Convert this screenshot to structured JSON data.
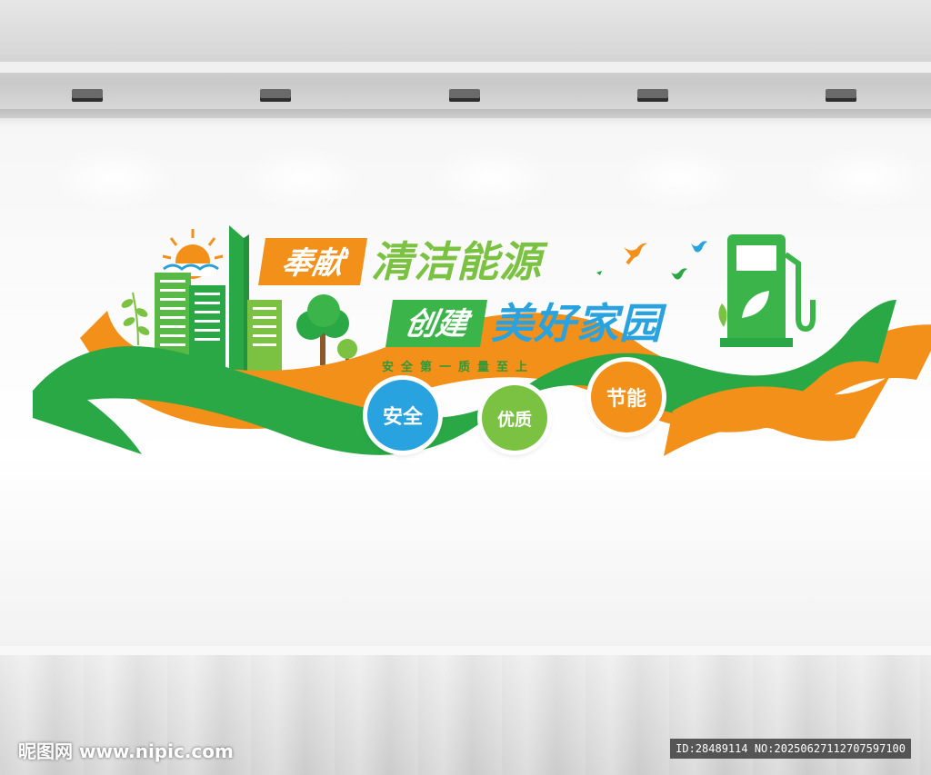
{
  "slogan": {
    "tag1": "奉献",
    "line1": "清洁能源",
    "tag2": "创建",
    "line2": "美好家园",
    "subline": "安全第一质量至上"
  },
  "badges": [
    {
      "label": "安全",
      "color": "#29a3e0"
    },
    {
      "label": "优质",
      "color": "#7cc242"
    },
    {
      "label": "节能",
      "color": "#f39019"
    }
  ],
  "colors": {
    "green": "#2aa845",
    "orange": "#f39019",
    "blue": "#29a3e0"
  },
  "watermark": {
    "site": "昵图网 www.nipic.com",
    "id": "ID:28489114 NO:20250627112707597100"
  }
}
